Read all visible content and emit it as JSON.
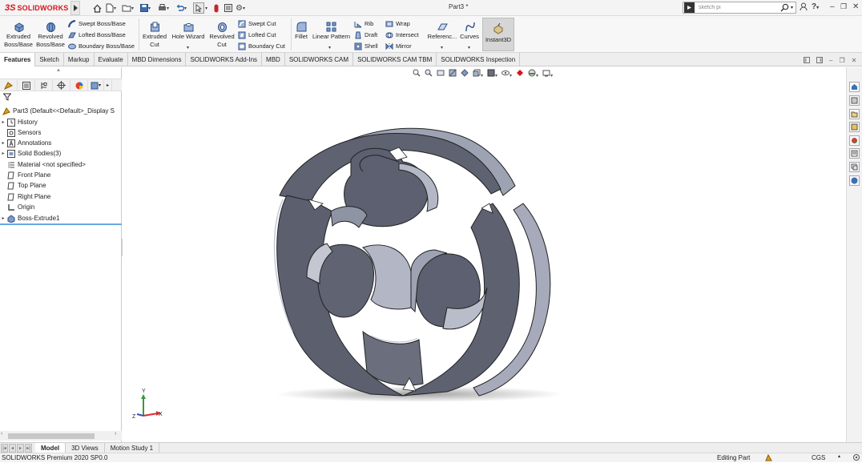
{
  "app": {
    "logo_ds": "3S",
    "logo_text": "SOLIDWORKS",
    "doc_title": "Part3 *"
  },
  "search": {
    "value": "sketch pi"
  },
  "help_label": "?",
  "toolbar": {
    "extruded_boss": [
      "Extruded",
      "Boss/Base"
    ],
    "revolved_boss": [
      "Revolved",
      "Boss/Base"
    ],
    "swept_boss": "Swept Boss/Base",
    "lofted_boss": "Lofted Boss/Base",
    "boundary_boss": "Boundary Boss/Base",
    "extruded_cut": [
      "Extruded",
      "Cut"
    ],
    "hole_wizard": "Hole Wizard",
    "revolved_cut": [
      "Revolved",
      "Cut"
    ],
    "swept_cut": "Swept Cut",
    "lofted_cut": "Lofted Cut",
    "boundary_cut": "Boundary Cut",
    "fillet": "Fillet",
    "linear_pattern": "Linear Pattern",
    "rib": "Rib",
    "draft": "Draft",
    "shell": "Shell",
    "wrap": "Wrap",
    "intersect": "Intersect",
    "mirror": "Mirror",
    "reference": "Referenc...",
    "curves": "Curves",
    "instant3d": "Instant3D"
  },
  "tabs": [
    "Features",
    "Sketch",
    "Markup",
    "Evaluate",
    "MBD Dimensions",
    "SOLIDWORKS Add-Ins",
    "MBD",
    "SOLIDWORKS CAM",
    "SOLIDWORKS CAM TBM",
    "SOLIDWORKS Inspection"
  ],
  "tree": {
    "root": "Part3  (Default<<Default>_Display S",
    "items": [
      "History",
      "Sensors",
      "Annotations",
      "Solid Bodies(3)",
      "Material <not specified>",
      "Front Plane",
      "Top Plane",
      "Right Plane",
      "Origin",
      "Boss-Extrude1"
    ]
  },
  "triad": {
    "x": "X",
    "y": "Y",
    "z": "Z"
  },
  "bottom_tabs": [
    "Model",
    "3D Views",
    "Motion Study 1"
  ],
  "status": {
    "version": "SOLIDWORKS Premium 2020 SP0.0",
    "mode": "Editing Part",
    "units": "CGS"
  },
  "colors": {
    "brand_red": "#d7141a",
    "part_gray": "#5d6170",
    "part_light": "#b9bdca",
    "selection_blue": "#6aa8e0"
  }
}
